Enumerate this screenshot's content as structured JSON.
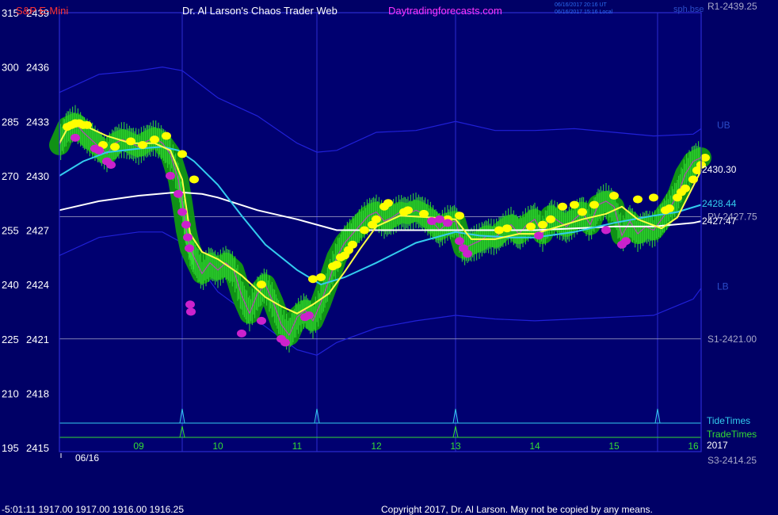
{
  "header": {
    "instrument": "S&P E-Mini",
    "title": "Dr. Al Larson's Chaos Trader Web",
    "site": "Daytradingforecasts.com",
    "timestamp_utc": "06/16/2017 20:16 UT",
    "timestamp_local": "06/16/2017 15:16 Local",
    "corner_label": "sph.bse"
  },
  "footer": {
    "readout": "-5:01:11  1917.00 1917.00 1916.00 1916.25",
    "copyright": "Copyright 2017, Dr. Al Larson. May not be copied by any means."
  },
  "colors": {
    "background": "#000066",
    "plot_bg": "#000070",
    "frame": "#2b2bd0",
    "vline": "#2b2bd0",
    "hline": "#a8a8c8",
    "bands": "#2020d8",
    "sma": "#ffffff",
    "ema_cyan": "#33ccee",
    "ema_yellow": "#ffff44",
    "price_bars": "#33dd33",
    "glow": "#119911",
    "dot_up": "#ffff00",
    "dot_down": "#cc22cc",
    "tide": "#33ccee",
    "trade": "#33dd33",
    "axis_text": "#ffffff",
    "time_text": "#33dd33",
    "title_red": "#ff3333",
    "title_white": "#ffffff",
    "title_magenta": "#ff33ff"
  },
  "chart_data": {
    "type": "line",
    "ylim": [
      2415,
      2439
    ],
    "xlim": [
      8.0,
      16.1
    ],
    "left_axis": {
      "ticks": [
        {
          "osc": "315",
          "price": "2439",
          "value": 2439
        },
        {
          "osc": "300",
          "price": "2436",
          "value": 2436
        },
        {
          "osc": "285",
          "price": "2433",
          "value": 2433
        },
        {
          "osc": "270",
          "price": "2430",
          "value": 2430
        },
        {
          "osc": "255",
          "price": "2427",
          "value": 2427
        },
        {
          "osc": "240",
          "price": "2424",
          "value": 2424
        },
        {
          "osc": "225",
          "price": "2421",
          "value": 2421
        },
        {
          "osc": "210",
          "price": "2418",
          "value": 2418
        },
        {
          "osc": "195",
          "price": "2415",
          "value": 2415
        }
      ]
    },
    "x_ticks": [
      {
        "label": "09",
        "x": 9.0
      },
      {
        "label": "10",
        "x": 10.0
      },
      {
        "label": "11",
        "x": 11.0
      },
      {
        "label": "12",
        "x": 12.0
      },
      {
        "label": "13",
        "x": 13.0
      },
      {
        "label": "14",
        "x": 14.0
      },
      {
        "label": "15",
        "x": 15.0
      },
      {
        "label": "16",
        "x": 16.0
      }
    ],
    "date_label": {
      "text": "06/16",
      "x": 8.3
    },
    "year_label": "2017",
    "vertical_lines": [
      9.55,
      11.25,
      13.0,
      15.55
    ],
    "levels": [
      {
        "label": "R1-2439.25",
        "value": 2439.25
      },
      {
        "label": "PV-2427.75",
        "value": 2427.75
      },
      {
        "label": "S1-2421.00",
        "value": 2421.0
      },
      {
        "label": "S3-2414.25",
        "value": 2414.25
      }
    ],
    "band_labels": [
      {
        "label": "UB",
        "value": 2432.8
      },
      {
        "label": "LB",
        "value": 2423.9
      }
    ],
    "value_labels": [
      {
        "label": "2430.30",
        "value": 2430.3,
        "color": "#ffffff"
      },
      {
        "label": "2428.44",
        "value": 2428.44,
        "color": "#33ccee"
      },
      {
        "label": "2427.47",
        "value": 2427.47,
        "color": "#ffffff"
      }
    ],
    "tide_label": "TideTimes",
    "trade_label": "TradeTimes",
    "tide_spikes": [
      9.55,
      11.25,
      13.0,
      15.55
    ],
    "trade_spikes": [
      9.55,
      13.0
    ],
    "series": [
      {
        "id": "upper-band",
        "x": [
          8.0,
          8.5,
          9.0,
          9.3,
          9.55,
          10.0,
          10.5,
          11.0,
          11.25,
          11.5,
          12.0,
          12.5,
          13.0,
          13.5,
          14.0,
          14.5,
          15.0,
          15.5,
          16.0,
          16.1
        ],
        "y": [
          2434.6,
          2435.6,
          2435.8,
          2436.0,
          2435.8,
          2434.3,
          2433.3,
          2431.8,
          2431.3,
          2431.4,
          2432.4,
          2432.5,
          2433.0,
          2432.5,
          2432.5,
          2432.6,
          2432.4,
          2432.2,
          2432.3,
          2432.6
        ]
      },
      {
        "id": "lower-band",
        "x": [
          8.0,
          8.5,
          9.0,
          9.3,
          9.55,
          10.0,
          10.5,
          11.0,
          11.25,
          11.5,
          12.0,
          12.5,
          13.0,
          13.5,
          14.0,
          14.5,
          15.0,
          15.5,
          16.0,
          16.1
        ],
        "y": [
          2425.6,
          2426.6,
          2426.9,
          2426.9,
          2426.3,
          2423.6,
          2422.0,
          2420.4,
          2420.1,
          2420.8,
          2421.6,
          2422.0,
          2422.3,
          2422.1,
          2422.0,
          2422.1,
          2422.2,
          2422.3,
          2423.2,
          2423.8
        ]
      },
      {
        "id": "sma-white",
        "x": [
          8.0,
          8.5,
          9.0,
          9.5,
          9.8,
          10.0,
          10.5,
          11.0,
          11.5,
          12.0,
          12.5,
          13.0,
          13.5,
          14.0,
          14.5,
          15.0,
          15.5,
          16.0,
          16.1
        ],
        "y": [
          2428.1,
          2428.6,
          2428.9,
          2429.1,
          2429.0,
          2428.8,
          2428.1,
          2427.6,
          2427.0,
          2427.0,
          2427.0,
          2427.0,
          2427.0,
          2427.0,
          2427.1,
          2427.2,
          2427.2,
          2427.4,
          2427.5
        ]
      },
      {
        "id": "ema-cyan",
        "x": [
          8.0,
          8.3,
          8.6,
          9.0,
          9.3,
          9.5,
          9.7,
          10.0,
          10.3,
          10.6,
          11.0,
          11.3,
          11.6,
          12.0,
          12.5,
          13.0,
          13.3,
          13.7,
          14.0,
          14.5,
          15.0,
          15.5,
          15.8,
          16.1
        ],
        "y": [
          2430.0,
          2430.8,
          2431.3,
          2431.5,
          2431.6,
          2431.4,
          2430.8,
          2429.5,
          2427.8,
          2426.2,
          2424.8,
          2424.0,
          2424.4,
          2425.2,
          2426.3,
          2426.9,
          2426.7,
          2426.6,
          2426.6,
          2426.9,
          2427.4,
          2427.8,
          2428.0,
          2428.4
        ]
      },
      {
        "id": "ema-yellow",
        "x": [
          8.0,
          8.1,
          8.3,
          8.6,
          8.9,
          9.2,
          9.4,
          9.55,
          9.65,
          9.8,
          10.0,
          10.3,
          10.6,
          10.8,
          11.0,
          11.2,
          11.4,
          11.6,
          11.8,
          12.0,
          12.3,
          12.7,
          13.0,
          13.2,
          13.5,
          13.8,
          14.0,
          14.3,
          14.6,
          14.9,
          15.1,
          15.3,
          15.6,
          15.8,
          16.1
        ],
        "y": [
          2431.8,
          2432.6,
          2432.8,
          2432.2,
          2431.8,
          2431.8,
          2431.4,
          2429.8,
          2426.8,
          2425.8,
          2425.4,
          2424.5,
          2423.3,
          2422.8,
          2422.4,
          2422.9,
          2423.5,
          2424.7,
          2426.0,
          2427.2,
          2427.8,
          2427.7,
          2427.6,
          2426.5,
          2426.5,
          2426.8,
          2426.8,
          2427.2,
          2427.6,
          2427.9,
          2428.3,
          2427.6,
          2427.1,
          2427.7,
          2430.3
        ]
      },
      {
        "id": "price",
        "x": [
          8.0,
          8.1,
          8.2,
          8.3,
          8.4,
          8.5,
          8.6,
          8.7,
          8.8,
          8.9,
          9.0,
          9.1,
          9.2,
          9.3,
          9.4,
          9.5,
          9.55,
          9.6,
          9.65,
          9.7,
          9.8,
          9.9,
          10.0,
          10.1,
          10.2,
          10.3,
          10.4,
          10.5,
          10.6,
          10.7,
          10.8,
          10.9,
          11.0,
          11.1,
          11.2,
          11.3,
          11.4,
          11.5,
          11.6,
          11.7,
          11.8,
          11.9,
          12.0,
          12.1,
          12.2,
          12.3,
          12.4,
          12.5,
          12.6,
          12.7,
          12.8,
          12.9,
          13.0,
          13.1,
          13.2,
          13.3,
          13.4,
          13.5,
          13.6,
          13.7,
          13.8,
          13.9,
          14.0,
          14.1,
          14.2,
          14.3,
          14.4,
          14.5,
          14.6,
          14.7,
          14.8,
          14.9,
          15.0,
          15.1,
          15.2,
          15.3,
          15.4,
          15.5,
          15.6,
          15.7,
          15.8,
          15.9,
          16.0,
          16.1
        ],
        "y": [
          2431.7,
          2432.7,
          2432.9,
          2432.4,
          2432.0,
          2431.6,
          2431.2,
          2431.8,
          2432.0,
          2431.8,
          2431.6,
          2431.9,
          2432.1,
          2431.8,
          2431.2,
          2429.8,
          2428.5,
          2427.0,
          2426.0,
          2425.5,
          2424.6,
          2425.2,
          2424.8,
          2425.2,
          2424.8,
          2423.4,
          2422.4,
          2423.5,
          2424.0,
          2423.0,
          2421.8,
          2421.2,
          2422.2,
          2422.6,
          2422.0,
          2423.0,
          2424.2,
          2425.5,
          2426.3,
          2426.8,
          2427.3,
          2427.8,
          2428.0,
          2427.5,
          2427.7,
          2428.0,
          2427.9,
          2428.1,
          2427.9,
          2427.5,
          2427.0,
          2427.4,
          2427.5,
          2426.0,
          2426.2,
          2426.4,
          2426.7,
          2426.6,
          2427.0,
          2427.3,
          2426.8,
          2427.3,
          2427.6,
          2426.8,
          2427.8,
          2427.5,
          2427.2,
          2427.6,
          2428.0,
          2427.3,
          2428.4,
          2428.6,
          2428.3,
          2426.7,
          2427.5,
          2426.8,
          2427.2,
          2427.0,
          2427.6,
          2428.2,
          2428.9,
          2430.1,
          2430.8,
          2431.0
        ]
      },
      {
        "id": "dots-up",
        "x": [
          8.1,
          8.15,
          8.2,
          8.25,
          8.3,
          8.35,
          8.55,
          8.7,
          8.9,
          9.05,
          9.2,
          9.35,
          9.55,
          9.7,
          10.55,
          11.2,
          11.3,
          11.45,
          11.5,
          11.55,
          11.6,
          11.65,
          11.7,
          11.85,
          11.95,
          12.0,
          12.1,
          12.15,
          12.35,
          12.4,
          12.6,
          12.9,
          13.05,
          13.55,
          13.65,
          13.95,
          14.1,
          14.2,
          14.35,
          14.5,
          14.6,
          14.75,
          15.0,
          15.3,
          15.5,
          15.65,
          15.7,
          15.8,
          15.85,
          15.9,
          16.0,
          16.05,
          16.1,
          16.15
        ],
        "y": [
          2432.7,
          2432.8,
          2432.9,
          2432.9,
          2432.8,
          2432.8,
          2431.7,
          2431.6,
          2431.9,
          2431.7,
          2432.0,
          2432.2,
          2431.2,
          2429.8,
          2424.0,
          2424.3,
          2424.4,
          2425.0,
          2425.1,
          2425.5,
          2425.6,
          2425.9,
          2426.2,
          2427.0,
          2427.3,
          2427.6,
          2428.3,
          2428.5,
          2428.0,
          2428.1,
          2427.9,
          2427.6,
          2427.8,
          2427.0,
          2427.1,
          2427.2,
          2427.3,
          2427.6,
          2428.3,
          2428.4,
          2428.0,
          2428.4,
          2428.9,
          2428.7,
          2428.8,
          2428.1,
          2428.2,
          2428.8,
          2429.1,
          2429.3,
          2429.8,
          2430.3,
          2430.6,
          2431.0
        ]
      },
      {
        "id": "dots-down",
        "x": [
          8.2,
          8.45,
          8.5,
          8.6,
          8.65,
          9.4,
          9.5,
          9.55,
          9.6,
          9.62,
          9.64,
          9.65,
          9.66,
          10.3,
          10.55,
          10.8,
          10.85,
          11.1,
          11.15,
          12.7,
          12.8,
          12.9,
          13.05,
          13.1,
          13.15,
          14.05,
          14.9,
          15.1,
          15.15
        ],
        "y": [
          2432.1,
          2431.5,
          2431.4,
          2430.8,
          2430.6,
          2430.0,
          2429.0,
          2428.0,
          2427.3,
          2426.6,
          2426.0,
          2422.9,
          2422.5,
          2421.3,
          2422.0,
          2421.0,
          2420.8,
          2422.2,
          2422.3,
          2427.5,
          2427.6,
          2427.4,
          2426.4,
          2426.0,
          2425.7,
          2426.7,
          2427.0,
          2426.2,
          2426.4
        ]
      }
    ]
  }
}
